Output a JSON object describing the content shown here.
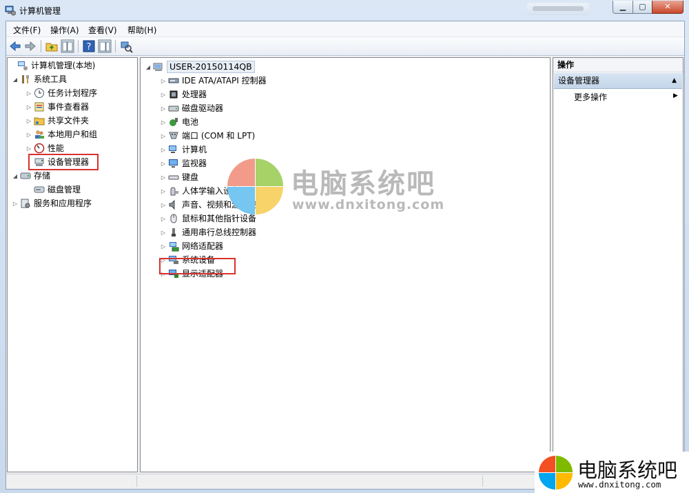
{
  "window": {
    "title": "计算机管理"
  },
  "menu": [
    "文件(F)",
    "操作(A)",
    "查看(V)",
    "帮助(H)"
  ],
  "left_tree": [
    {
      "label": "计算机管理(本地)",
      "icon": "computer-management-icon",
      "expander": ""
    },
    {
      "label": "系统工具",
      "icon": "tools-icon",
      "expander": "◢"
    },
    {
      "label": "任务计划程序",
      "icon": "clock-icon",
      "expander": "▷"
    },
    {
      "label": "事件查看器",
      "icon": "event-viewer-icon",
      "expander": "▷"
    },
    {
      "label": "共享文件夹",
      "icon": "shared-folder-icon",
      "expander": "▷"
    },
    {
      "label": "本地用户和组",
      "icon": "users-icon",
      "expander": "▷"
    },
    {
      "label": "性能",
      "icon": "performance-icon",
      "expander": "▷"
    },
    {
      "label": "设备管理器",
      "icon": "device-manager-icon",
      "expander": ""
    },
    {
      "label": "存储",
      "icon": "storage-icon",
      "expander": "◢"
    },
    {
      "label": "磁盘管理",
      "icon": "disk-management-icon",
      "expander": ""
    },
    {
      "label": "服务和应用程序",
      "icon": "services-icon",
      "expander": "▷"
    }
  ],
  "device_tree": {
    "root": "USER-20150114QB",
    "items": [
      {
        "label": "IDE ATA/ATAPI 控制器",
        "icon": "ide-controller-icon"
      },
      {
        "label": "处理器",
        "icon": "processor-icon"
      },
      {
        "label": "磁盘驱动器",
        "icon": "disk-drive-icon"
      },
      {
        "label": "电池",
        "icon": "battery-icon"
      },
      {
        "label": "端口 (COM 和 LPT)",
        "icon": "port-icon"
      },
      {
        "label": "计算机",
        "icon": "computer-icon"
      },
      {
        "label": "监视器",
        "icon": "monitor-icon"
      },
      {
        "label": "键盘",
        "icon": "keyboard-icon"
      },
      {
        "label": "人体学输入设备",
        "icon": "hid-icon"
      },
      {
        "label": "声音、视频和游戏控制器",
        "icon": "sound-icon"
      },
      {
        "label": "鼠标和其他指针设备",
        "icon": "mouse-icon"
      },
      {
        "label": "通用串行总线控制器",
        "icon": "usb-icon"
      },
      {
        "label": "网络适配器",
        "icon": "network-adapter-icon"
      },
      {
        "label": "系统设备",
        "icon": "system-device-icon"
      },
      {
        "label": "显示适配器",
        "icon": "display-adapter-icon"
      }
    ]
  },
  "actions": {
    "header": "操作",
    "group": "设备管理器",
    "more": "更多操作"
  },
  "watermark": {
    "title": "电脑系统吧",
    "url": "www.dnxitong.com"
  },
  "colors": {
    "highlight": "#d8312c",
    "logo": [
      "#f25022",
      "#7fba00",
      "#00a4ef",
      "#ffb900"
    ]
  }
}
